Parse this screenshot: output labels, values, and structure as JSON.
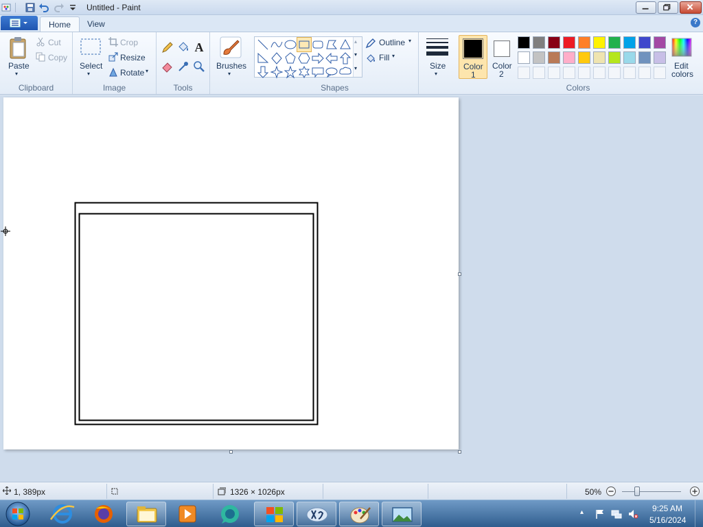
{
  "window": {
    "title": "Untitled - Paint"
  },
  "tabs": [
    {
      "label": "Home"
    },
    {
      "label": "View"
    }
  ],
  "help": "?",
  "clipboard": {
    "paste": "Paste",
    "cut": "Cut",
    "copy": "Copy",
    "group": "Clipboard"
  },
  "image": {
    "select": "Select",
    "crop": "Crop",
    "resize": "Resize",
    "rotate": "Rotate",
    "group": "Image"
  },
  "tools": {
    "group": "Tools",
    "text_glyph": "A"
  },
  "brushes": {
    "label": "Brushes"
  },
  "shapes": {
    "outline": "Outline",
    "fill": "Fill",
    "group": "Shapes"
  },
  "size": {
    "label": "Size"
  },
  "color1": {
    "line1": "Color",
    "line2": "1",
    "value": "#000000"
  },
  "color2": {
    "line1": "Color",
    "line2": "2",
    "value": "#ffffff"
  },
  "colors": {
    "group": "Colors",
    "edit_line1": "Edit",
    "edit_line2": "colors",
    "palette_row1": [
      "#000000",
      "#7f7f7f",
      "#880015",
      "#ed1c24",
      "#ff7f27",
      "#fff200",
      "#22b14c",
      "#00a2e8",
      "#3f48cc",
      "#a349a4"
    ],
    "palette_row2": [
      "#ffffff",
      "#c3c3c3",
      "#b97a57",
      "#ffaec9",
      "#ffc90e",
      "#efe4b0",
      "#b5e61d",
      "#99d9ea",
      "#7092be",
      "#c8bfe7"
    ]
  },
  "status": {
    "cursor_pos": "1, 389px",
    "canvas_size": "1326 × 1026px",
    "zoom": "50%"
  },
  "taskbar": {
    "time": "9:25 AM",
    "date": "5/16/2024"
  }
}
